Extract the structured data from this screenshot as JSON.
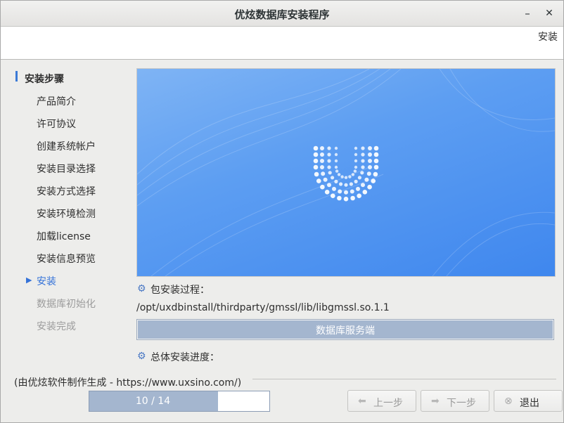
{
  "window": {
    "title": "优炫数据库安装程序",
    "minimize_glyph": "–",
    "close_glyph": "✕",
    "header_label": "安装"
  },
  "sidebar": {
    "heading": "安装步骤",
    "steps": [
      {
        "label": "产品简介",
        "state": "done"
      },
      {
        "label": "许可协议",
        "state": "done"
      },
      {
        "label": "创建系统帐户",
        "state": "done"
      },
      {
        "label": "安装目录选择",
        "state": "done"
      },
      {
        "label": "安装方式选择",
        "state": "done"
      },
      {
        "label": "安装环境检测",
        "state": "done"
      },
      {
        "label": "加载license",
        "state": "done"
      },
      {
        "label": "安装信息预览",
        "state": "done"
      },
      {
        "label": "安装",
        "state": "current"
      },
      {
        "label": "数据库初始化",
        "state": "pending"
      },
      {
        "label": "安装完成",
        "state": "pending"
      }
    ]
  },
  "main": {
    "package_label": "包安装过程：",
    "current_file": "/opt/uxdbinstall/thirdparty/gmssl/lib/libgmssl.so.1.1",
    "package_progress": {
      "text": "数据库服务端",
      "fraction": 1.0
    },
    "total_label": "总体安装进度：",
    "icon": "gear-icon"
  },
  "footer": {
    "credit": "(由优炫软件制作生成 - https://www.uxsino.com/)",
    "total_progress": {
      "text": "10 / 14",
      "fraction": 0.714
    },
    "buttons": {
      "prev_label": "上一步",
      "next_label": "下一步",
      "exit_label": "退出"
    }
  },
  "colors": {
    "accent": "#3472d8",
    "progress_fill": "#a4b6cf",
    "banner_blue": "#4f93f0"
  }
}
